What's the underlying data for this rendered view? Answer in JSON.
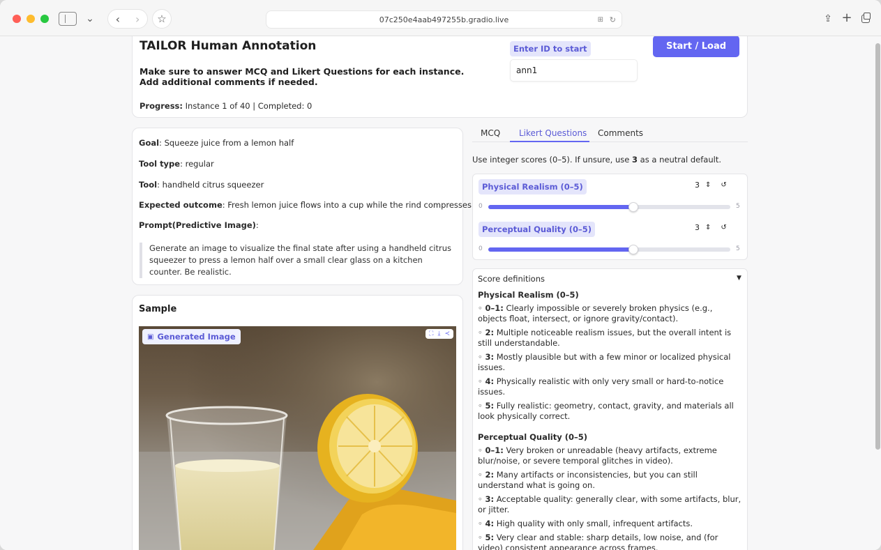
{
  "browser": {
    "url": "07c250e4aab497255b.gradio.live"
  },
  "header": {
    "title": "TAILOR Human Annotation",
    "instructions": "Make sure to answer MCQ and Likert Questions for each instance. Add additional comments if needed.",
    "progress_label": "Progress:",
    "progress_text": "Instance 1 of 40 | Completed: 0",
    "id_label": "Enter ID to start",
    "id_value": "ann1",
    "start_button": "Start / Load"
  },
  "task": {
    "goal_label": "Goal",
    "goal": ": Squeeze juice from a lemon half",
    "tool_type_label": "Tool type",
    "tool_type": ": regular",
    "tool_label": "Tool",
    "tool": ": handheld citrus squeezer",
    "expected_label": "Expected outcome",
    "expected": ": Fresh lemon juice flows into a cup while the rind compresses.",
    "prompt_label": "Prompt(Predictive Image)",
    "prompt_colon": ":",
    "prompt": "Generate an image to visualize the final state after using a handheld citrus squeezer to press a lemon half over a small clear glass on a kitchen counter. Be realistic."
  },
  "sample": {
    "title": "Sample",
    "image_badge": "Generated Image"
  },
  "tabs": [
    "MCQ",
    "Likert Questions",
    "Comments"
  ],
  "likert": {
    "intro_pre": "Use integer scores (0–5). If unsure, use ",
    "intro_bold": "3",
    "intro_post": " as a neutral default.",
    "physical_label": "Physical Realism (0–5)",
    "physical_value": 3,
    "perceptual_label": "Perceptual Quality (0–5)",
    "perceptual_value": 3,
    "min": "0",
    "max": "5"
  },
  "definitions": {
    "toggle": "Score definitions",
    "pr_title": "Physical Realism (0–5)",
    "pr": [
      {
        "k": "0–1:",
        "v": " Clearly impossible or severely broken physics (e.g., objects float, intersect, or ignore gravity/contact)."
      },
      {
        "k": "2:",
        "v": " Multiple noticeable realism issues, but the overall intent is still understandable."
      },
      {
        "k": "3:",
        "v": " Mostly plausible but with a few minor or localized physical issues."
      },
      {
        "k": "4:",
        "v": " Physically realistic with only very small or hard-to-notice issues."
      },
      {
        "k": "5:",
        "v": " Fully realistic: geometry, contact, gravity, and materials all look physically correct."
      }
    ],
    "pq_title": "Perceptual Quality (0–5)",
    "pq": [
      {
        "k": "0–1:",
        "v": " Very broken or unreadable (heavy artifacts, extreme blur/noise, or severe temporal glitches in video)."
      },
      {
        "k": "2:",
        "v": " Many artifacts or inconsistencies, but you can still understand what is going on."
      },
      {
        "k": "3:",
        "v": " Acceptable quality: generally clear, with some artifacts, blur, or jitter."
      },
      {
        "k": "4:",
        "v": " High quality with only small, infrequent artifacts."
      },
      {
        "k": "5:",
        "v": " Very clear and stable: sharp details, low noise, and (for video) consistent appearance across frames."
      }
    ]
  },
  "colors": {
    "accent": "#6366f1",
    "chip_bg": "#e4e5fb"
  }
}
